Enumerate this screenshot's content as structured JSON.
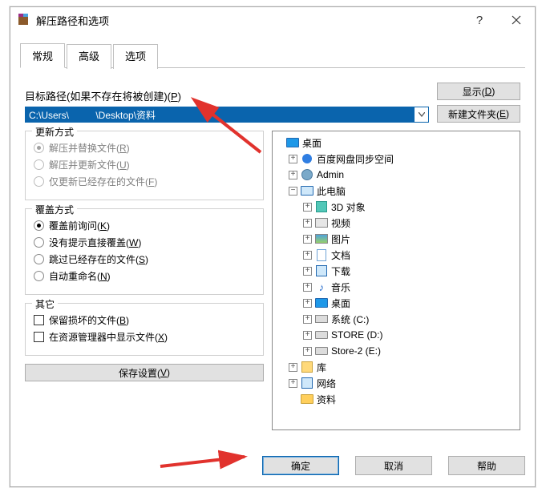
{
  "title": "解压路径和选项",
  "tabs": {
    "general": "常规",
    "advanced": "高级",
    "options": "选项"
  },
  "path": {
    "label_pre": "目标路径(如果不存在将被创建)(",
    "label_u": "P",
    "label_post": ")",
    "value": "C:\\Users\\          \\Desktop\\资料"
  },
  "side": {
    "show_pre": "显示(",
    "show_u": "D",
    "show_post": ")",
    "newfolder_pre": "新建文件夹(",
    "newfolder_u": "E",
    "newfolder_post": ")"
  },
  "update": {
    "legend": "更新方式",
    "opt1_pre": "解压并替换文件(",
    "opt1_u": "R",
    "opt1_post": ")",
    "opt2_pre": "解压并更新文件(",
    "opt2_u": "U",
    "opt2_post": ")",
    "opt3_pre": "仅更新已经存在的文件(",
    "opt3_u": "F",
    "opt3_post": ")"
  },
  "overwrite": {
    "legend": "覆盖方式",
    "opt1_pre": "覆盖前询问(",
    "opt1_u": "K",
    "opt1_post": ")",
    "opt2_pre": "没有提示直接覆盖(",
    "opt2_u": "W",
    "opt2_post": ")",
    "opt3_pre": "跳过已经存在的文件(",
    "opt3_u": "S",
    "opt3_post": ")",
    "opt4_pre": "自动重命名(",
    "opt4_u": "N",
    "opt4_post": ")"
  },
  "other": {
    "legend": "其它",
    "opt1_pre": "保留损坏的文件(",
    "opt1_u": "B",
    "opt1_post": ")",
    "opt2_pre": "在资源管理器中显示文件(",
    "opt2_u": "X",
    "opt2_post": ")"
  },
  "save_pre": "保存设置(",
  "save_u": "V",
  "save_post": ")",
  "tree": {
    "desktop": "桌面",
    "baidu": "百度网盘同步空间",
    "admin": "Admin",
    "thispc": "此电脑",
    "obj3d": "3D 对象",
    "video": "视频",
    "pictures": "图片",
    "docs": "文档",
    "downloads": "下载",
    "music": "音乐",
    "desk2": "桌面",
    "sysdrive": "系统 (C:)",
    "store_d": "STORE (D:)",
    "store2_e": "Store-2 (E:)",
    "library": "库",
    "network": "网络",
    "ziliao": "资料"
  },
  "buttons": {
    "ok": "确定",
    "cancel": "取消",
    "help": "帮助"
  }
}
